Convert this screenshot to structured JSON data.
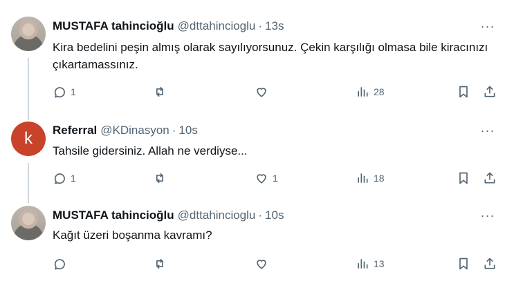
{
  "tweets": [
    {
      "name": "MUSTAFA tahincioğlu",
      "handle": "@dttahincioglu",
      "dot": "·",
      "time": "13s",
      "text": "Kira bedelini peşin almış olarak sayılıyorsunuz. Çekin karşılığı olmasa bile kiracınızı çıkartamassınız.",
      "replies": "1",
      "retweets": "",
      "likes": "",
      "views": "28",
      "avatar": "photo"
    },
    {
      "name": "Referral",
      "handle": "@KDinasyon",
      "dot": "·",
      "time": "10s",
      "text": "Tahsile gidersiniz. Allah ne verdiyse...",
      "replies": "1",
      "retweets": "",
      "likes": "1",
      "views": "18",
      "avatar": "letter",
      "avatar_letter": "k",
      "avatar_color": "#c9432a"
    },
    {
      "name": "MUSTAFA tahincioğlu",
      "handle": "@dttahincioglu",
      "dot": "·",
      "time": "10s",
      "text": "Kağıt üzeri boşanma kavramı?",
      "replies": "",
      "retweets": "",
      "likes": "",
      "views": "13",
      "avatar": "photo"
    }
  ],
  "icons": {
    "more": "more-icon",
    "reply": "reply-icon",
    "retweet": "retweet-icon",
    "like": "like-icon",
    "views": "views-icon",
    "bookmark": "bookmark-icon",
    "share": "share-icon"
  },
  "colors": {
    "text": "#0f1419",
    "secondary": "#536471",
    "thread_line": "#cfd9de"
  },
  "more_glyph": "···"
}
